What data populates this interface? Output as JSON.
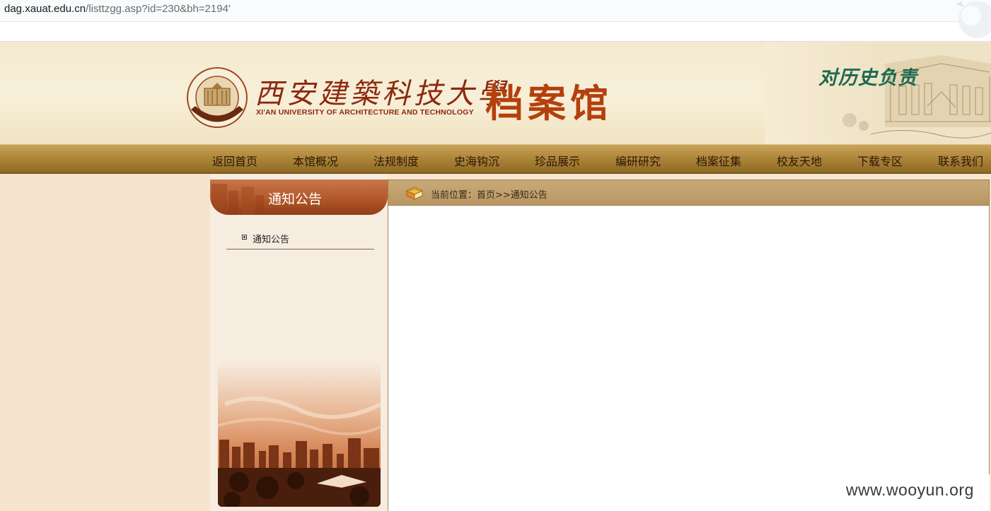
{
  "browser": {
    "url_host": "dag.xauat.edu.cn",
    "url_path": "/listtzgg.asp?id=230&bh=2194'"
  },
  "header": {
    "university_cn": "西安建築科技大學",
    "university_en": "XI'AN UNIVERSITY OF ARCHITECTURE AND TECHNOLOGY",
    "site_title": "档案馆",
    "motto": "对历史负责"
  },
  "nav": {
    "items": [
      {
        "label": "返回首页"
      },
      {
        "label": "本馆概况"
      },
      {
        "label": "法规制度"
      },
      {
        "label": "史海钩沉"
      },
      {
        "label": "珍品展示"
      },
      {
        "label": "编研研究"
      },
      {
        "label": "档案征集"
      },
      {
        "label": "校友天地"
      },
      {
        "label": "下载专区"
      },
      {
        "label": "联系我们"
      }
    ]
  },
  "sidebar": {
    "title": "通知公告",
    "items": [
      {
        "label": "通知公告"
      }
    ]
  },
  "breadcrumb": {
    "text": "当前位置：首页>>通知公告"
  },
  "watermark": "www.wooyun.org",
  "colors": {
    "title": "#b4400c",
    "nav_bar": "#ad8538",
    "sidebar_header": "#b3582a",
    "motto": "#1d6a50"
  }
}
